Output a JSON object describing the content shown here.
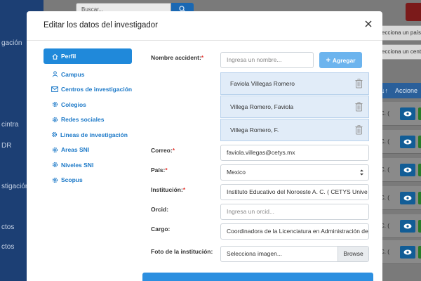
{
  "background": {
    "sidebar": {
      "items": [
        "gación",
        "cintra",
        "DR",
        "stigación",
        "ctos",
        "ctos"
      ]
    },
    "search_placeholder": "Buscar...",
    "filters": [
      "ecciona un país",
      "ecciona un cent"
    ],
    "table": {
      "actions_header": "Accione",
      "row_texts": [
        "C. (",
        "C. (",
        "C. (",
        "C. (",
        "C. (",
        "C. ("
      ]
    },
    "colors": {
      "sidebar": "#1c3f74",
      "primary": "#2089da",
      "danger": "#7b1a1a",
      "success": "#2a7a2a"
    }
  },
  "modal": {
    "title": "Editar los datos del investigador",
    "nav": [
      {
        "label": "Perfil",
        "icon": "home-icon",
        "active": true
      },
      {
        "label": "Campus",
        "icon": "user-icon",
        "active": false
      },
      {
        "label": "Centros de investigación",
        "icon": "envelope-icon",
        "active": false
      },
      {
        "label": "Colegios",
        "icon": "cog-icon",
        "active": false
      },
      {
        "label": "Redes sociales",
        "icon": "cog-icon",
        "active": false
      },
      {
        "label": "Lineas de investigación",
        "icon": "cog-icon",
        "active": false
      },
      {
        "label": "Areas SNI",
        "icon": "cog-icon",
        "active": false
      },
      {
        "label": "Niveles SNI",
        "icon": "cog-icon",
        "active": false
      },
      {
        "label": "Scopus",
        "icon": "cog-icon",
        "active": false
      }
    ],
    "form": {
      "nombre_label": "Nombre accident:",
      "nombre_placeholder": "Ingresa un nombre...",
      "add_label": "Agregar",
      "names": [
        "Faviola Villegas Romero",
        "Villega Romero, Faviola",
        "Villega Romero, F."
      ],
      "correo_label": "Correo:",
      "correo_value": "faviola.villegas@cetys.mx",
      "pais_label": "País:",
      "pais_value": "Mexico",
      "institucion_label": "Institución:",
      "institucion_value": "Instituto Educativo del Noroeste A. C. ( CETYS Unive",
      "orcid_label": "Orcid:",
      "orcid_placeholder": "Ingresa un orcid...",
      "cargo_label": "Cargo:",
      "cargo_value": "Coordinadora de la Licenciatura en Administración de E",
      "foto_label": "Foto de la institución:",
      "foto_placeholder": "Selecciona imagen...",
      "browse_label": "Browse"
    }
  }
}
